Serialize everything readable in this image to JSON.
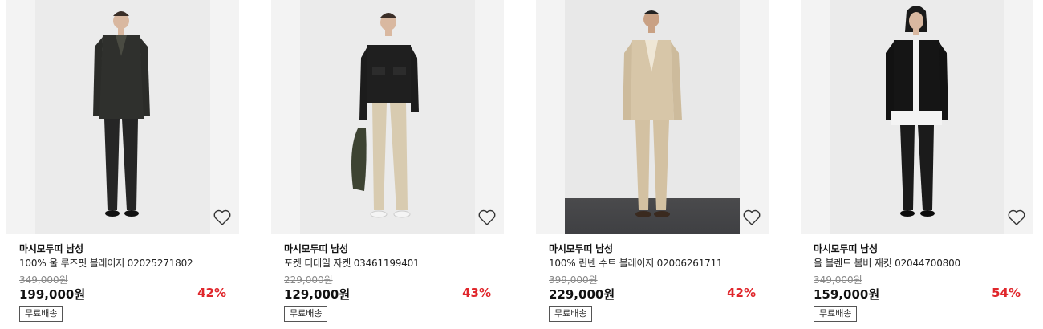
{
  "products": [
    {
      "brand": "마시모두띠 남성",
      "name": "100% 울 루즈핏 블레이저 02025271802",
      "original_price": "349,000원",
      "price": "199,000원",
      "discount": "42%",
      "badge": "무료배송",
      "wishlist_icon": "heart-outline-icon"
    },
    {
      "brand": "마시모두띠 남성",
      "name": "포켓 디테일 자켓 03461199401",
      "original_price": "229,000원",
      "price": "129,000원",
      "discount": "43%",
      "badge": "무료배송",
      "wishlist_icon": "heart-outline-icon"
    },
    {
      "brand": "마시모두띠 남성",
      "name": "100% 린넨 수트 블레이저 02006261711",
      "original_price": "399,000원",
      "price": "229,000원",
      "discount": "42%",
      "badge": "무료배송",
      "wishlist_icon": "heart-outline-icon"
    },
    {
      "brand": "마시모두띠 남성",
      "name": "울 블렌드 봄버 재킷 02044700800",
      "original_price": "349,000원",
      "price": "159,000원",
      "discount": "54%",
      "badge": "무료배송",
      "wishlist_icon": "heart-outline-icon"
    }
  ],
  "colors": {
    "discount": "#e0262b",
    "image_background": "#f3f3f3",
    "strike_price": "#888888"
  }
}
